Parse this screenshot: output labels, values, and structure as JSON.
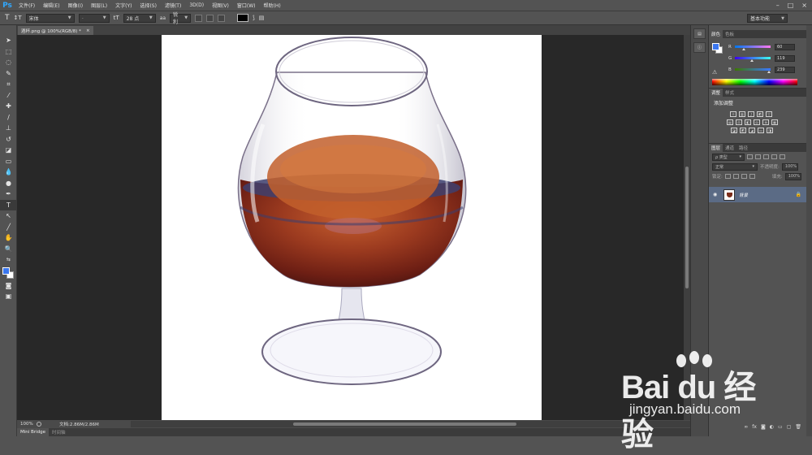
{
  "app": {
    "logo": "Ps",
    "menu": [
      "文件(F)",
      "编辑(E)",
      "图像(I)",
      "图层(L)",
      "文字(Y)",
      "选择(S)",
      "滤镜(T)",
      "3D(D)",
      "视图(V)",
      "窗口(W)",
      "帮助(H)"
    ],
    "window_controls": [
      "–",
      "□",
      "×"
    ]
  },
  "options_bar": {
    "tool_icon": "T",
    "font_family": "宋体",
    "font_style": "-",
    "font_size": "28 点",
    "antialias_label": "aa",
    "antialias_value": "锐利",
    "text_color": "#000000",
    "workspace": "基本功能"
  },
  "toolbar": {
    "tools": [
      "move-tool",
      "marquee-tool",
      "lasso-tool",
      "quick-select-tool",
      "crop-tool",
      "eyedropper-tool",
      "healing-brush-tool",
      "brush-tool",
      "clone-stamp-tool",
      "history-brush-tool",
      "eraser-tool",
      "gradient-tool",
      "blur-tool",
      "dodge-tool",
      "pen-tool",
      "type-tool",
      "path-select-tool",
      "line-tool",
      "hand-tool",
      "zoom-tool"
    ],
    "active_tool": "type-tool",
    "foreground_color": "#3b77ef",
    "background_color": "#ffffff"
  },
  "document": {
    "tab_title": "酒杯.png @ 100%(RGB/8) *",
    "tab_close": "×"
  },
  "status": {
    "zoom": "100%",
    "doc_info": "文档:2.86M/2.86M",
    "arrow": "▶"
  },
  "bottom_panel": {
    "tabs": [
      "Mini Bridge",
      "时间轴"
    ]
  },
  "color_panel": {
    "tabs": [
      "颜色",
      "色板"
    ],
    "r_label": "R",
    "r_value": "60",
    "g_label": "G",
    "g_value": "119",
    "b_label": "B",
    "b_value": "239",
    "warning": "⚠"
  },
  "adjustments_panel": {
    "tabs": [
      "调整",
      "样式"
    ],
    "title": "添加调整"
  },
  "layers_panel": {
    "tabs": [
      "图层",
      "通道",
      "路径"
    ],
    "filter_label": "ρ 类型",
    "blend_mode": "正常",
    "opacity_label": "不透明度:",
    "opacity_value": "100%",
    "lock_label": "锁定:",
    "fill_label": "填充:",
    "fill_value": "100%",
    "layer_name": "背景",
    "lock_icon": "🔒"
  },
  "watermark": {
    "logo_text": "Bai du 经验",
    "url": "jingyan.baidu.com"
  }
}
